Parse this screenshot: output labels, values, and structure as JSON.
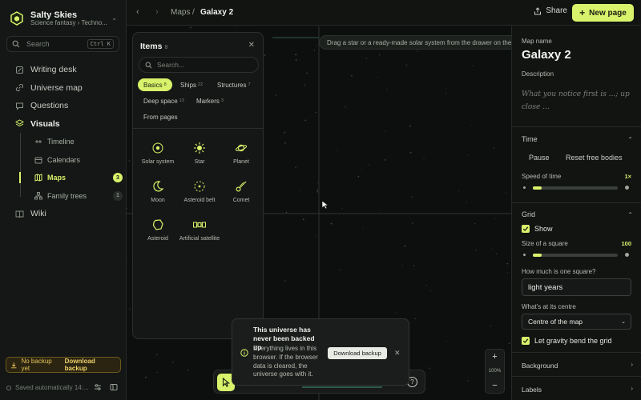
{
  "app": {
    "name": "Salty Skies",
    "subtitle": "Science fantasy › Techno..."
  },
  "search": {
    "placeholder": "Search",
    "shortcut": "Ctrl K"
  },
  "nav": {
    "items": [
      {
        "label": "Writing desk",
        "icon": "pen-icon"
      },
      {
        "label": "Universe map",
        "icon": "link-icon"
      },
      {
        "label": "Questions",
        "icon": "chat-icon"
      },
      {
        "label": "Visuals",
        "icon": "layers-icon"
      }
    ],
    "visuals_sub": [
      {
        "label": "Timeline",
        "icon": "timeline-icon",
        "count": ""
      },
      {
        "label": "Calendars",
        "icon": "calendar-icon",
        "count": ""
      },
      {
        "label": "Maps",
        "icon": "map-icon",
        "count": "3"
      },
      {
        "label": "Family trees",
        "icon": "tree-icon",
        "count": "1"
      }
    ],
    "wiki": "Wiki"
  },
  "backup": {
    "warning": "No backup yet",
    "action": "Download backup"
  },
  "saved_status": "Saved automatically 14:...",
  "topbar": {
    "crumb_maps": "Maps",
    "sep": "/",
    "crumb_current": "Galaxy 2",
    "share": "Share",
    "new_page": "New page"
  },
  "canvas": {
    "hint": "Drag a star or a ready-made solar system from the drawer on the left"
  },
  "drawer": {
    "title": "Items",
    "count": "8",
    "search_placeholder": "Search...",
    "chips": [
      {
        "label": "Basics",
        "count": "8"
      },
      {
        "label": "Ships",
        "count": "22"
      },
      {
        "label": "Structures",
        "count": "7"
      },
      {
        "label": "Deep space",
        "count": "13"
      },
      {
        "label": "Markers",
        "count": "3"
      },
      {
        "label": "From pages",
        "count": ""
      }
    ],
    "tiles": [
      {
        "label": "Solar system",
        "icon": "solar-system-icon"
      },
      {
        "label": "Star",
        "icon": "star-icon"
      },
      {
        "label": "Planet",
        "icon": "planet-icon"
      },
      {
        "label": "Moon",
        "icon": "moon-icon"
      },
      {
        "label": "Asteroid belt",
        "icon": "asteroid-belt-icon"
      },
      {
        "label": "Comet",
        "icon": "comet-icon"
      },
      {
        "label": "Asteroid",
        "icon": "asteroid-icon"
      },
      {
        "label": "Artificial satellite",
        "icon": "satellite-icon"
      }
    ]
  },
  "toast": {
    "title": "This universe has never been backed up",
    "body": "Everything lives in this browser. If the browser data is cleared, the universe goes with it.",
    "button": "Download backup"
  },
  "zoom": {
    "plus": "+",
    "level": "100%",
    "minus": "−"
  },
  "panel": {
    "map_name_label": "Map name",
    "map_name": "Galaxy 2",
    "description_label": "Description",
    "description_placeholder": "What you notice first is ...; up close ...",
    "time": {
      "label": "Time",
      "pause": "Pause",
      "reset": "Reset free bodies",
      "speed_label": "Speed of time",
      "speed_value": "1×",
      "speed_fraction": 0.1
    },
    "grid": {
      "label": "Grid",
      "show": "Show",
      "size_label": "Size of a square",
      "size_value": "100",
      "size_fraction": 0.1,
      "unit_label": "How much is one square?",
      "unit_value": "light years",
      "centre_label": "What's at its centre",
      "centre_value": "Centre of the map",
      "gravity": "Let gravity bend the grid"
    },
    "background": "Background",
    "labels": "Labels"
  },
  "colors": {
    "accent": "#d9f26b",
    "background": "#0e100f",
    "warning": "#e7c45a"
  }
}
